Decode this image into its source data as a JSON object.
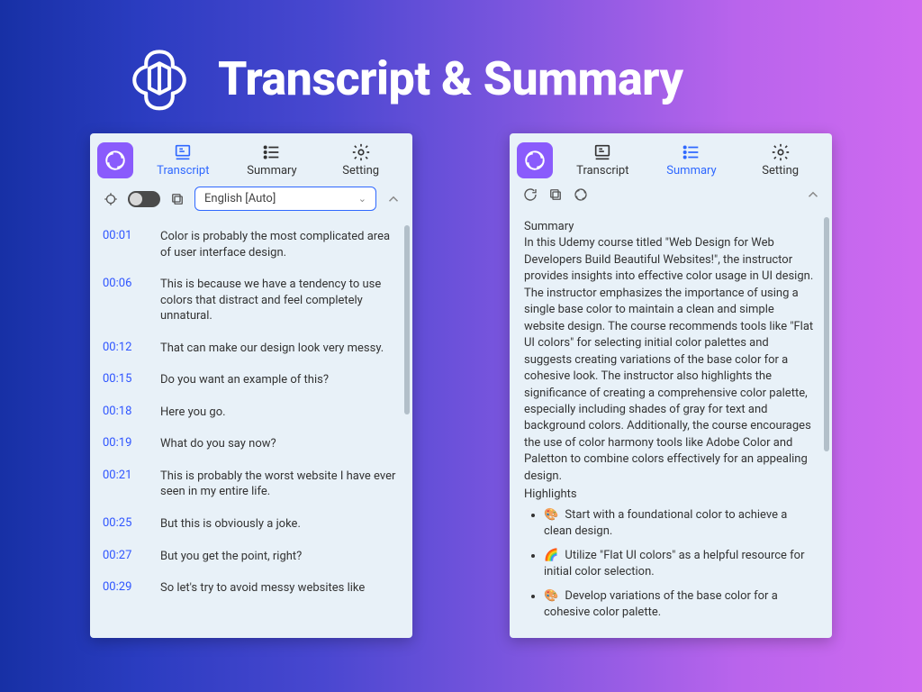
{
  "hero": {
    "title": "Transcript & Summary"
  },
  "tabs": {
    "transcript": "Transcript",
    "summary": "Summary",
    "setting": "Setting"
  },
  "left": {
    "language": "English [Auto]",
    "lines": [
      {
        "t": "00:01",
        "x": "Color is probably the most complicated area of user interface design."
      },
      {
        "t": "00:06",
        "x": "This is because we have a tendency to use colors that distract and feel completely unnatural."
      },
      {
        "t": "00:12",
        "x": "That can make our design look very messy."
      },
      {
        "t": "00:15",
        "x": "Do you want an example of this?"
      },
      {
        "t": "00:18",
        "x": "Here you go."
      },
      {
        "t": "00:19",
        "x": "What do you say now?"
      },
      {
        "t": "00:21",
        "x": "This is probably the worst website I have ever seen in my entire life."
      },
      {
        "t": "00:25",
        "x": "But this is obviously a joke."
      },
      {
        "t": "00:27",
        "x": "But you get the point, right?"
      },
      {
        "t": "00:29",
        "x": "So let's try to avoid messy websites like"
      }
    ]
  },
  "right": {
    "heading_summary": "Summary",
    "summary_body": "In this Udemy course titled \"Web Design for Web Developers Build Beautiful Websites!\", the instructor provides insights into effective color usage in UI design. The instructor emphasizes the importance of using a single base color to maintain a clean and simple website design. The course recommends tools like \"Flat UI colors\" for selecting initial color palettes and suggests creating variations of the base color for a cohesive look. The instructor also highlights the significance of creating a comprehensive color palette, especially including shades of gray for text and background colors. Additionally, the course encourages the use of color harmony tools like Adobe Color and Paletton to combine colors effectively for an appealing design.",
    "heading_highlights": "Highlights",
    "highlights": [
      {
        "e": "🎨",
        "x": "Start with a foundational color to achieve a clean design."
      },
      {
        "e": "🌈",
        "x": "Utilize \"Flat UI colors\" as a helpful resource for initial color selection."
      },
      {
        "e": "🎨",
        "x": "Develop variations of the base color for a cohesive color palette."
      }
    ]
  }
}
